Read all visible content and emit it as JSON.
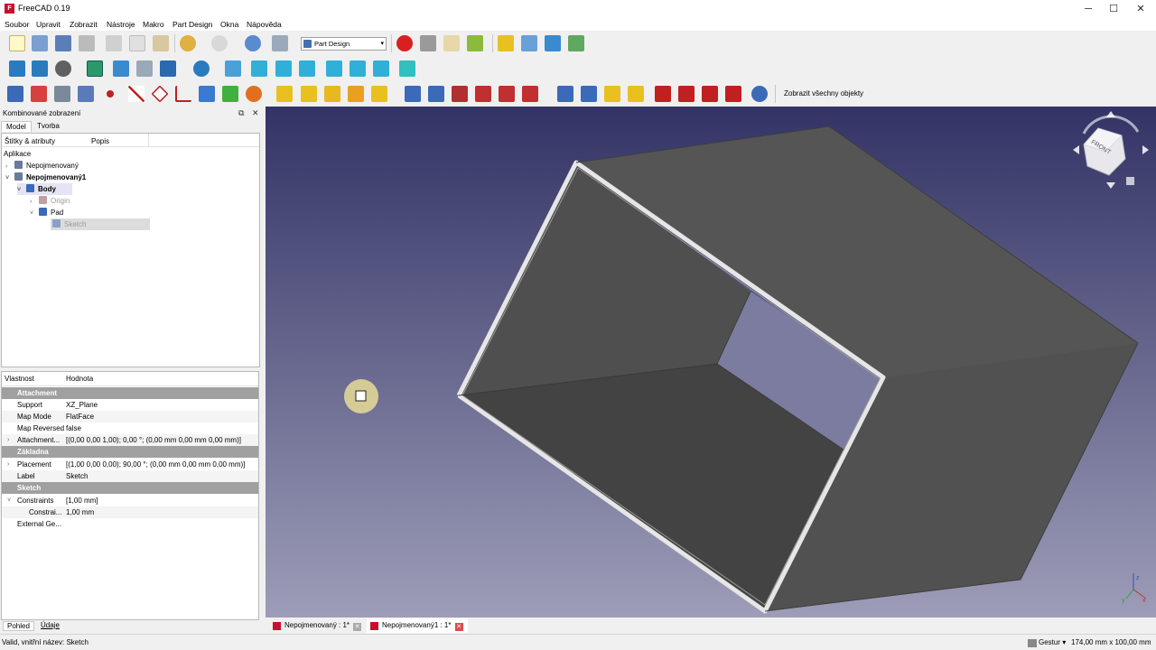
{
  "window": {
    "title": "FreeCAD 0.19",
    "minimize": "─",
    "maximize": "☐",
    "close": "✕"
  },
  "menu": [
    "Soubor",
    "Upravit",
    "Zobrazit",
    "Nástroje",
    "Makro",
    "Part Design",
    "Okna",
    "Nápověda"
  ],
  "toolbar": {
    "workbench": "Part Design",
    "show_all_label": "Zobrazit všechny objekty"
  },
  "combo": {
    "title": "Kombinované zobrazení",
    "float_icon": "⧉",
    "close_icon": "✕",
    "tabs": [
      "Model",
      "Tvorba"
    ],
    "tree_header": [
      "Štítky & atributy",
      "Popis"
    ],
    "applications_label": "Aplikace",
    "tree": [
      {
        "label": "Nepojmenovaný",
        "arrow": "›"
      },
      {
        "label": "Nepojmenovaný1",
        "arrow": "˅"
      },
      {
        "label": "Body",
        "arrow": "˅"
      },
      {
        "label": "Origin",
        "arrow": "›"
      },
      {
        "label": "Pad",
        "arrow": "˅"
      },
      {
        "label": "Sketch",
        "arrow": ""
      }
    ]
  },
  "properties": {
    "header": [
      "Vlastnost",
      "Hodnota"
    ],
    "groups": {
      "attachment": "Attachment",
      "zakladna": "Základna",
      "sketch": "Sketch"
    },
    "rows": {
      "support": [
        "Support",
        "XZ_Plane"
      ],
      "map_mode": [
        "Map Mode",
        "FlatFace"
      ],
      "map_reversed": [
        "Map Reversed",
        "false"
      ],
      "attachment_offset": [
        "Attachment...",
        "[(0,00 0,00 1,00); 0,00 °; (0,00 mm  0,00 mm  0,00 mm)]"
      ],
      "placement": [
        "Placement",
        "[(1,00 0,00 0,00); 90,00 °; (0,00 mm  0,00 mm  0,00 mm)]"
      ],
      "label": [
        "Label",
        "Sketch"
      ],
      "constraints": [
        "Constraints",
        "[1,00 mm]"
      ],
      "constraint_1": [
        "Constrai...",
        "1,00 mm"
      ],
      "external_geo": [
        "External Ge...",
        ""
      ]
    },
    "expand_arrow": "›",
    "collapse_arrow": "˅"
  },
  "bottom_tabs": [
    "Pohled",
    "Údaje"
  ],
  "doc_tabs": [
    "Nepojmenovaný : 1*",
    "Nepojmenovaný1 : 1*"
  ],
  "doc_tab_close": "✕",
  "navcube": {
    "face_label": "FRONT"
  },
  "axis_labels": {
    "x": "x",
    "y": "y",
    "z": "z"
  },
  "status": {
    "message": "Valid, vnitřní název: Sketch",
    "nav_style": "Gestur ▾",
    "dimensions": "174,00 mm x 100,00 mm"
  },
  "colors": {
    "bg_top": "#333366",
    "bg_bottom": "#9d9db8",
    "face_dark": "#4b4b4b",
    "face_light": "#5d5d5d",
    "edge": "#e6e6e6",
    "group_row": "#a0a0a0",
    "accent_red": "#c8102e"
  }
}
